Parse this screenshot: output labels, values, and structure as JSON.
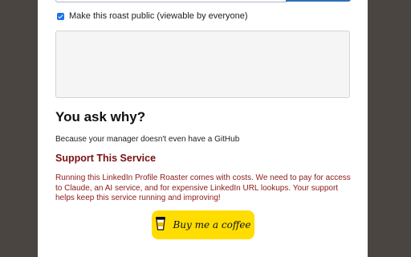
{
  "visibility": {
    "public_label": "Make this roast public (viewable by everyone)",
    "checked": true
  },
  "why": {
    "heading": "You ask why?",
    "reason": "Because your manager doesn't even have a GitHub"
  },
  "support": {
    "title": "Support This Service",
    "text": "Running this LinkedIn Profile Roaster comes with costs. We need to pay for access to Claude, an AI service, and for expensive LinkedIn URL lookups. Your support helps keep this service running and improving!"
  },
  "coffee": {
    "label": "Buy me a coffee",
    "icon": "coffee-cup-icon"
  },
  "colors": {
    "backdrop": "#4a4540",
    "accent_yellow": "#ffdd00",
    "support_red": "#8b1a1a",
    "checkbox_blue": "#1a73e8"
  }
}
